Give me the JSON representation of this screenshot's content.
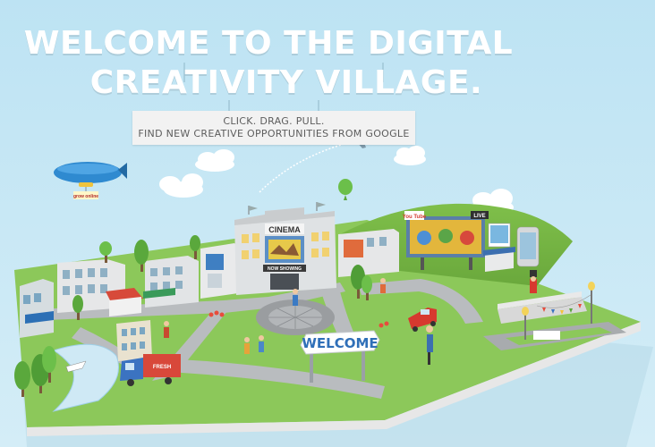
{
  "headline": {
    "line1": "WELCOME TO THE DIGITAL",
    "line2": "CREATIVITY VILLAGE."
  },
  "tagline": {
    "line1": "CLICK. DRAG. PULL.",
    "line2": "FIND NEW CREATIVE OPPORTUNITIES FROM GOOGLE"
  },
  "village": {
    "cinema_sign": "CINEMA",
    "cinema_marquee": "NOW SHOWING",
    "welcome_sign": "WELCOME",
    "billboard_brand": "You Tube",
    "billboard_live": "LIVE",
    "truck_text": "FRESH",
    "blimp_text": "grow online"
  },
  "colors": {
    "sky": "#c7e7f4",
    "grass": "#8cc85a",
    "road": "#b9bcbf",
    "truck": "#d8483a",
    "blimp": "#2f8ad0",
    "welcome_text": "#2f6fb8"
  },
  "icons": {
    "blimp": "blimp-icon",
    "airplane": "airplane-icon",
    "balloon": "balloon-icon"
  }
}
